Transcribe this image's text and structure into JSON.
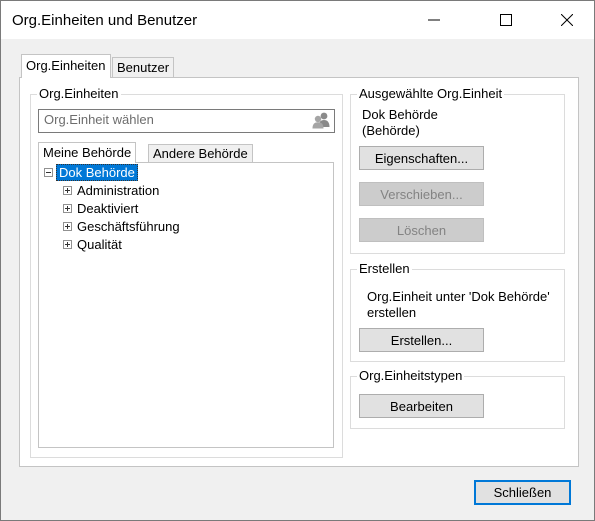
{
  "window": {
    "title": "Org.Einheiten und Benutzer"
  },
  "tabs": [
    {
      "label": "Org.Einheiten",
      "active": true
    },
    {
      "label": "Benutzer",
      "active": false
    }
  ],
  "org_units": {
    "group_label": "Org.Einheiten",
    "search": {
      "placeholder": "Org.Einheit wählen"
    },
    "subtabs": [
      {
        "label": "Meine Behörde",
        "active": true
      },
      {
        "label": "Andere Behörde",
        "active": false
      }
    ],
    "tree": {
      "root": {
        "label": "Dok Behörde",
        "expanded": true,
        "selected": true
      },
      "children": [
        {
          "label": "Administration"
        },
        {
          "label": "Deaktiviert"
        },
        {
          "label": "Geschäftsführung"
        },
        {
          "label": "Qualität"
        }
      ]
    }
  },
  "selected_unit": {
    "group_label": "Ausgewählte Org.Einheit",
    "name_line1": "Dok Behörde",
    "name_line2": "(Behörde)",
    "buttons": {
      "properties": "Eigenschaften...",
      "move": "Verschieben...",
      "delete": "Löschen"
    }
  },
  "create": {
    "group_label": "Erstellen",
    "text_line1": "Org.Einheit unter 'Dok Behörde'",
    "text_line2": "erstellen",
    "button": "Erstellen..."
  },
  "unit_types": {
    "group_label": "Org.Einheitstypen",
    "button": "Bearbeiten"
  },
  "footer": {
    "close_button": "Schließen"
  },
  "colors": {
    "selection": "#0078d7",
    "default_button_border": "#0078d7",
    "window_background": "#f0f0f0"
  }
}
